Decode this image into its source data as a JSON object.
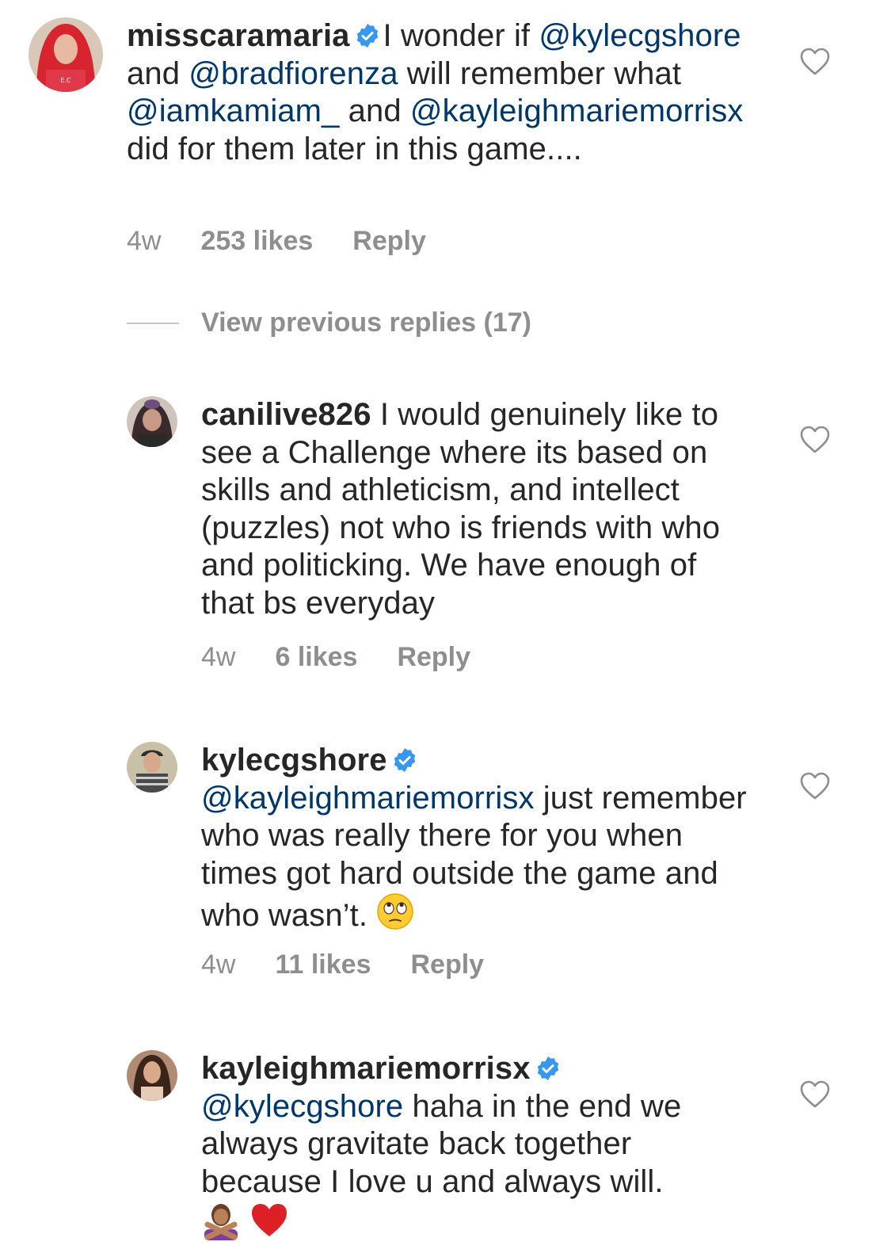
{
  "comments": [
    {
      "username": "misscaramaria",
      "verified": true,
      "segments": [
        {
          "t": "I wonder if "
        },
        {
          "m": "@kylecgshore"
        },
        {
          "t": " and "
        },
        {
          "m": "@bradfiorenza"
        },
        {
          "t": " will remember what "
        },
        {
          "m": "@iamkamiam_"
        },
        {
          "t": " and "
        },
        {
          "m": "@kayleighmariemorrisx"
        },
        {
          "t": " did for them later in this game...."
        }
      ],
      "age": "4w",
      "likes": "253 likes",
      "reply": "Reply"
    },
    {
      "username": "canilive826",
      "verified": false,
      "segments": [
        {
          "t": "I would genuinely like to see a Challenge where its based on skills and athleticism, and intellect (puzzles) not who is friends with who and politicking. We have enough  of that bs everyday"
        }
      ],
      "age": "4w",
      "likes": "6 likes",
      "reply": "Reply"
    },
    {
      "username": "kylecgshore",
      "verified": true,
      "segments": [
        {
          "m": "@kayleighmariemorrisx"
        },
        {
          "t": " just remember who was really there for you when times got hard outside the game and who wasn’t. "
        }
      ],
      "emoji": [
        "face-with-rolling-eyes-icon"
      ],
      "age": "4w",
      "likes": "11 likes",
      "reply": "Reply"
    },
    {
      "username": "kayleighmariemorrisx",
      "verified": true,
      "segments": [
        {
          "m": "@kylecgshore"
        },
        {
          "t": " haha in the end we always gravitate back together because I love u and always will."
        }
      ],
      "emoji": [
        "person-gesturing-no-icon",
        "red-heart-icon"
      ]
    }
  ],
  "view_replies": "View previous replies (17)",
  "colors": {
    "text": "#262626",
    "mention": "#00376b",
    "meta": "#8e8e8e",
    "verified": "#3897f0"
  }
}
